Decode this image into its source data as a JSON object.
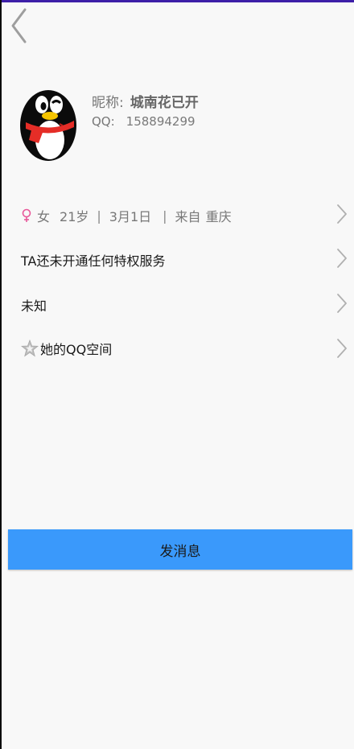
{
  "colors": {
    "top_accent": "#3d1fa8",
    "button_bg": "#3a99fb",
    "female_pink": "#e8589a",
    "chevron": "#b0b0b0",
    "star": "#bdbdbd"
  },
  "icons": {
    "back": "chevron-left",
    "avatar": "qq-penguin",
    "gender": "female-symbol",
    "row_arrow": "chevron-right",
    "qzone": "star"
  },
  "profile": {
    "nick_label": "昵称:",
    "nick_value": "城南花已开",
    "qq_label": "QQ:",
    "qq_value": "158894299"
  },
  "info": {
    "gender": "女",
    "age": "21岁",
    "divider": "|",
    "birthday": "3月1日",
    "from_label": "来自",
    "location": "重庆"
  },
  "rows": {
    "privilege": "TA还未开通任何特权服务",
    "unknown": "未知",
    "qzone": "她的QQ空间"
  },
  "send_button": "发消息"
}
